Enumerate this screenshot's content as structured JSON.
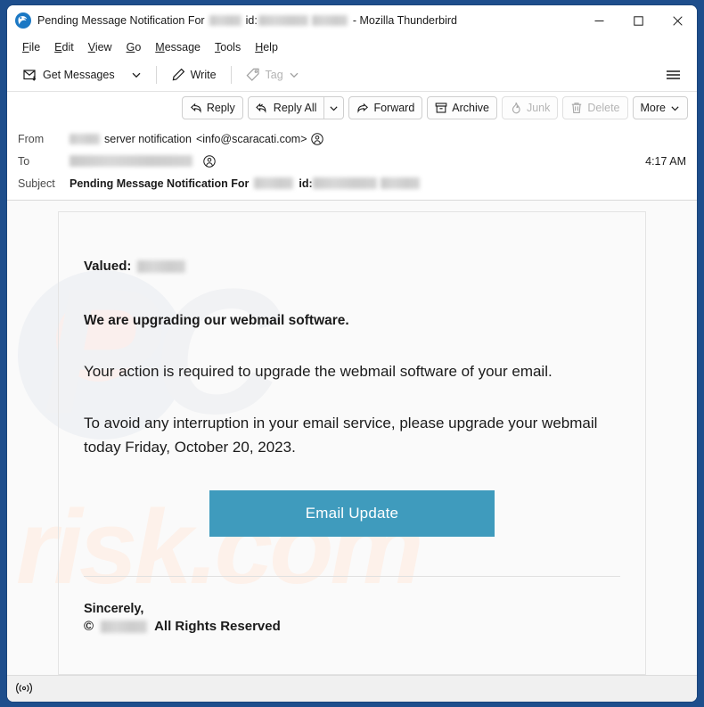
{
  "window": {
    "title_prefix": "Pending Message Notification For",
    "title_id_label": "id:",
    "title_suffix": "- Mozilla Thunderbird",
    "app_icon": "thunderbird-icon",
    "minimize_label": "─",
    "maximize_label": "□",
    "close_label": "✕"
  },
  "menubar": {
    "items": [
      {
        "pre": "",
        "key": "F",
        "post": "ile"
      },
      {
        "pre": "",
        "key": "E",
        "post": "dit"
      },
      {
        "pre": "",
        "key": "V",
        "post": "iew"
      },
      {
        "pre": "",
        "key": "G",
        "post": "o"
      },
      {
        "pre": "",
        "key": "M",
        "post": "essage"
      },
      {
        "pre": "",
        "key": "T",
        "post": "ools"
      },
      {
        "pre": "",
        "key": "H",
        "post": "elp"
      }
    ]
  },
  "toolbar": {
    "get_messages": "Get Messages",
    "write": "Write",
    "tag": "Tag",
    "menu_icon": "hamburger-icon"
  },
  "message_actions": {
    "reply": "Reply",
    "reply_all": "Reply All",
    "forward": "Forward",
    "archive": "Archive",
    "junk": "Junk",
    "delete": "Delete",
    "more": "More"
  },
  "headers": {
    "from_label": "From",
    "from_text": "server notification",
    "from_email": "<info@scaracati.com>",
    "to_label": "To",
    "subject_label": "Subject",
    "subject_prefix": "Pending Message Notification For",
    "subject_id_label": "id:",
    "time": "4:17 AM"
  },
  "email": {
    "greeting_label": "Valued:",
    "heading": "We are upgrading our webmail software.",
    "paragraph_1": "Your action is required to upgrade the webmail software of your email.",
    "paragraph_2": "To avoid any interruption in your email service, please upgrade your webmail today Friday, October 20, 2023.",
    "cta_button": "Email Update",
    "signoff": "Sincerely,",
    "copyright_symbol": "©",
    "rights_text": "All Rights Reserved",
    "watermark_top": "PC",
    "watermark_bottom": "risk.com"
  },
  "statusbar": {
    "connection_icon": "broadcast-icon"
  },
  "colors": {
    "cta_button": "#3f9bbd",
    "window_border": "#1e4e8c",
    "body_background": "#fafafa"
  }
}
